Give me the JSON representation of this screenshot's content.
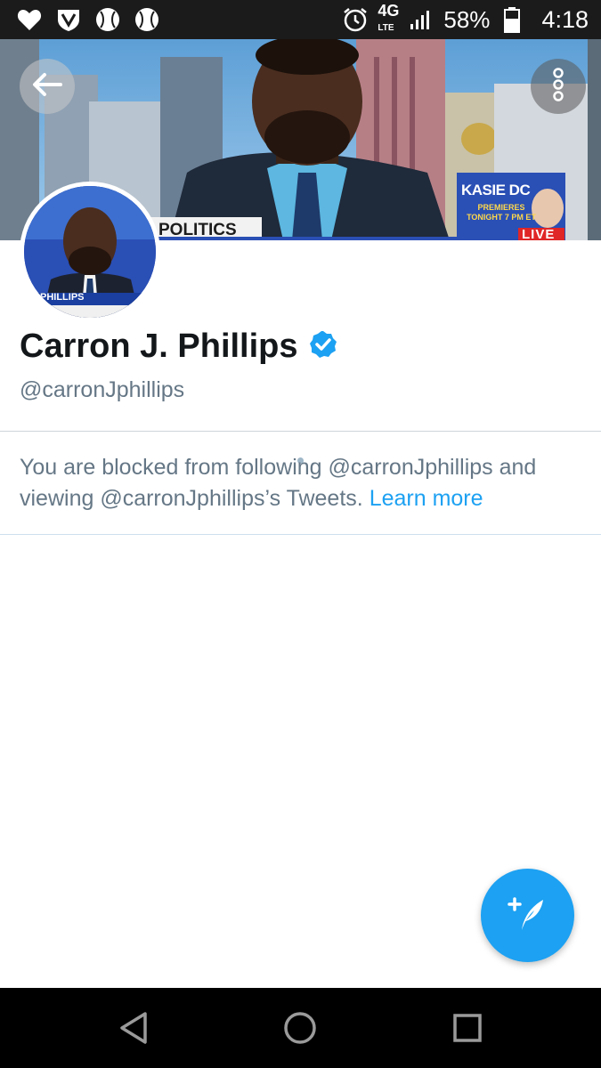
{
  "status_bar": {
    "left_icons": [
      "heart-icon",
      "shield-v-icon",
      "baseball-icon",
      "baseball-icon"
    ],
    "network_label": "4G",
    "network_sub": "LTE",
    "battery_percent": "58%",
    "time": "4:18"
  },
  "banner": {
    "politics_label": "POLITICS",
    "promo_title": "KASIE DC",
    "promo_subtitle": "PREMIERES TONIGHT 7 PM ET",
    "live_label": "LIVE",
    "overlay_color": "#2a4fb5"
  },
  "avatar": {
    "caption": "PHILLIPS"
  },
  "profile": {
    "display_name": "Carron J. Phillips",
    "verified": true,
    "handle": "@carronJphillips"
  },
  "blocked_notice": {
    "message": "You are blocked from following @carronJphillips and viewing @carronJphillips’s Tweets.",
    "learn_more": "Learn more"
  },
  "colors": {
    "accent": "#1da1f2",
    "secondary_text": "#657786",
    "primary_text": "#14171a"
  },
  "fab": {
    "icon": "compose-tweet-icon"
  },
  "nav_bar": {
    "buttons": [
      "back-triangle-icon",
      "home-circle-icon",
      "recents-square-icon"
    ]
  }
}
